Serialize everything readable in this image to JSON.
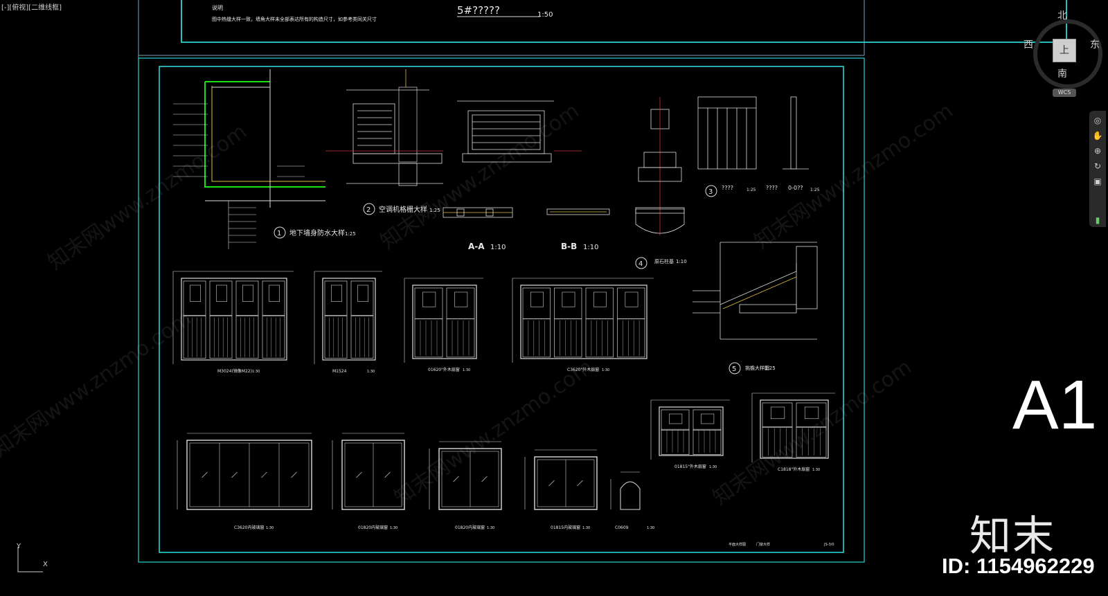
{
  "viewport": {
    "label": "[-][俯视][二维线框]"
  },
  "header_note": {
    "title": "说明",
    "body": "图中热缝大样一致，墙角大样未全部表达所有的构造尺寸，如参考类同关尺寸",
    "ref": "5#?????",
    "ref_scale": "1:50"
  },
  "details": {
    "d1": {
      "num": "1",
      "title": "地下墙身防水大样",
      "scale": "1:25"
    },
    "d2": {
      "num": "2",
      "title": "空调机格栅大样",
      "scale": "1:25"
    },
    "aa": {
      "title": "A-A",
      "scale": "1:10"
    },
    "bb": {
      "title": "B-B",
      "scale": "1:10"
    },
    "d3": {
      "num": "3",
      "title": "????",
      "scale": "1:25",
      "title2": "????",
      "sub2": "0-0??",
      "scale2": "1:25"
    },
    "d4": {
      "num": "4",
      "title": "原石柱基",
      "scale": "1:10"
    },
    "d5": {
      "num": "5",
      "title": "挑檐大样图",
      "scale": "1:25"
    }
  },
  "windows_row1": [
    {
      "label": "M3024(镜像M22)",
      "scale": "1:30"
    },
    {
      "label": "M1524",
      "scale": "1:30"
    },
    {
      "label": "01620\"外木扇窗",
      "scale": "1:30"
    },
    {
      "label": "C3620\"外木扇窗",
      "scale": "1:30"
    }
  ],
  "windows_row2": [
    {
      "label": "C3620内玻璃窗",
      "scale": "1:30"
    },
    {
      "label": "01820内玻璃窗",
      "scale": "1:30"
    },
    {
      "label": "01820内玻璃窗",
      "scale": "1:30"
    },
    {
      "label": "01815内玻璃窗",
      "scale": "1:30"
    },
    {
      "label": "C0609",
      "scale": "1:30"
    }
  ],
  "windows_right": [
    {
      "label": "01815\"外木扇窗",
      "scale": "1:30"
    },
    {
      "label": "C1818\"外木扇窗",
      "scale": "1:30"
    }
  ],
  "title_block": {
    "text1": "平面大样图",
    "text2": "门窗大样",
    "sheet_code": "JS-3/0"
  },
  "viewcube": {
    "north": "北",
    "south": "南",
    "east": "东",
    "west": "西",
    "face": "上",
    "wcs": "WCS"
  },
  "ucs": {
    "y": "Y",
    "x": "X"
  },
  "sheet_size": "A1",
  "brand": "知末",
  "id_text": "ID: 1154962229",
  "watermark": "知末网www.znzmo.com",
  "colors": {
    "border": "#2ad4d4",
    "green": "#19e019",
    "yellow": "#e0c040",
    "white": "#e8e8e8"
  }
}
